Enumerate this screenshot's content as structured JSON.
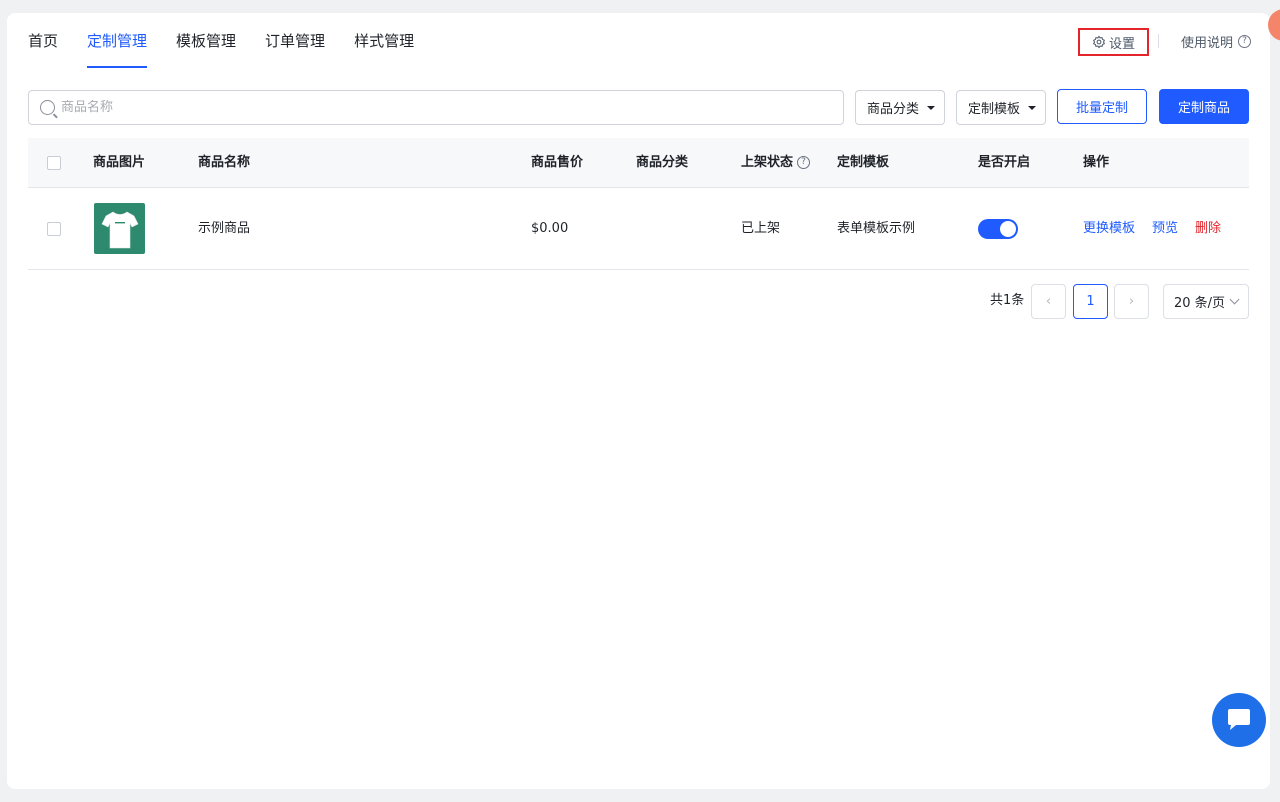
{
  "nav": {
    "tabs": [
      {
        "label": "首页",
        "active": false
      },
      {
        "label": "定制管理",
        "active": true
      },
      {
        "label": "模板管理",
        "active": false
      },
      {
        "label": "订单管理",
        "active": false
      },
      {
        "label": "样式管理",
        "active": false
      }
    ],
    "settings_label": "设置",
    "help_label": "使用说明"
  },
  "toolbar": {
    "search_placeholder": "商品名称",
    "category_select": "商品分类",
    "template_select": "定制模板",
    "batch_button": "批量定制",
    "custom_button": "定制商品"
  },
  "table": {
    "columns": [
      "商品图片",
      "商品名称",
      "商品售价",
      "商品分类",
      "上架状态",
      "定制模板",
      "是否开启",
      "操作"
    ],
    "rows": [
      {
        "name": "示例商品",
        "price": "$0.00",
        "category": "",
        "status": "已上架",
        "template": "表单模板示例",
        "enabled": true,
        "actions": [
          "更换模板",
          "预览",
          "删除"
        ]
      }
    ]
  },
  "pagination": {
    "total": "共1条",
    "current_page": "1",
    "page_size": "20 条/页"
  },
  "colors": {
    "primary": "#1f5bff",
    "danger": "#e3242b",
    "highlight_box": "#e3242b"
  }
}
